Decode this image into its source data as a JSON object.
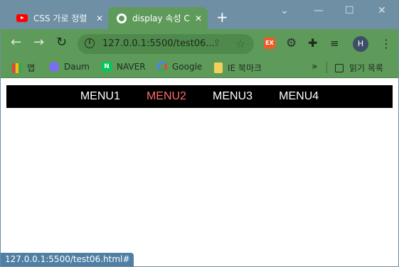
{
  "tabs": [
    {
      "title": "CSS 가로 정렬",
      "close": "✕",
      "favicon": "youtube-icon"
    },
    {
      "title": "display 속성 C",
      "close": "✕",
      "favicon": "globe-icon"
    }
  ],
  "window_controls": {
    "minimize": "—",
    "restore": "☐",
    "close": "✕",
    "tab_search": "⌄"
  },
  "toolbar": {
    "back": "←",
    "forward": "→",
    "reload": "↻",
    "url": "127.0.0.1:5500/test06...",
    "ext_label": "EX",
    "profile_initial": "H",
    "menu": "⋮"
  },
  "bookmarks": {
    "items": [
      {
        "label": "앱"
      },
      {
        "label": "Daum"
      },
      {
        "label": "NAVER",
        "icon_text": "N"
      },
      {
        "label": "Google"
      },
      {
        "label": "IE 북마크"
      }
    ],
    "more": "»",
    "reading_list": "읽기 목록"
  },
  "page": {
    "menu": [
      {
        "label": "MENU1",
        "state": "normal"
      },
      {
        "label": "MENU2",
        "state": "hover"
      },
      {
        "label": "MENU3",
        "state": "normal"
      },
      {
        "label": "MENU4",
        "state": "normal"
      }
    ]
  },
  "status_bar": {
    "url": "127.0.0.1:5500/test06.html#"
  },
  "colors": {
    "titlebar": "#6f8fa4",
    "toolbar": "#5e9b5b",
    "menu_bg": "#000000",
    "menu_text": "#ffffff",
    "menu_hover": "#ff6b6b"
  }
}
